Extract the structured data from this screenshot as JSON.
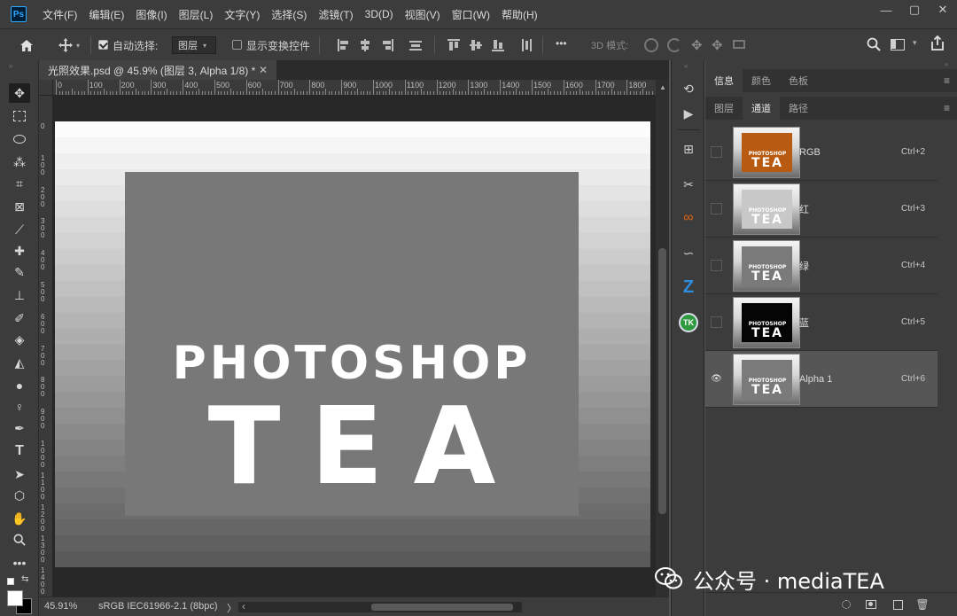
{
  "app": {
    "logo": "Ps"
  },
  "menubar": {
    "items": [
      "文件(F)",
      "编辑(E)",
      "图像(I)",
      "图层(L)",
      "文字(Y)",
      "选择(S)",
      "滤镜(T)",
      "3D(D)",
      "视图(V)",
      "窗口(W)",
      "帮助(H)"
    ],
    "window_controls": {
      "minimize": "—",
      "maximize": "▢",
      "close": "✕"
    }
  },
  "options": {
    "auto_select_label": "自动选择:",
    "auto_select_checked": true,
    "auto_select_target": "图层",
    "show_transform_label": "显示变换控件",
    "show_transform_checked": false,
    "more": "•••",
    "mode_3d_label": "3D 模式:"
  },
  "document": {
    "tab_title": "光照效果.psd @ 45.9% (图层 3, Alpha 1/8) *",
    "close": "✕",
    "canvas_text_top": "PHOTOSHOP",
    "canvas_text_bottom": "TEA",
    "colors": {
      "inner_rect": "#787878",
      "text": "#ffffff"
    }
  },
  "ruler": {
    "h_labels": [
      "0",
      "100",
      "200",
      "300",
      "400",
      "500",
      "600",
      "700",
      "800",
      "900",
      "1000",
      "1100",
      "1200",
      "1300",
      "1400",
      "1500",
      "1600",
      "1700",
      "1800"
    ],
    "v_labels": [
      "0",
      "1\n0\n0",
      "2\n0\n0",
      "3\n0\n0",
      "4\n0\n0",
      "5\n0\n0",
      "6\n0\n0",
      "7\n0\n0",
      "8\n0\n0",
      "9\n0\n0",
      "1\n0\n0\n0",
      "1\n1\n0\n0",
      "1\n2\n0\n0",
      "1\n3\n0\n0",
      "1\n4\n0\n0"
    ]
  },
  "status": {
    "zoom": "45.91%",
    "color_profile": "sRGB IEC61966-2.1 (8bpc)",
    "arrow_right": "〉",
    "arrow_left": "‹"
  },
  "panels": {
    "top_tabs": [
      "信息",
      "颜色",
      "色板"
    ],
    "top_active": 0,
    "bottom_tabs": [
      "图层",
      "通道",
      "路径"
    ],
    "bottom_active": 1,
    "menu_icon": "≡",
    "channels": [
      {
        "name": "RGB",
        "shortcut": "Ctrl+2",
        "visible": false,
        "thumb_fill": "#b85a10",
        "selected": false
      },
      {
        "name": "红",
        "shortcut": "Ctrl+3",
        "visible": false,
        "thumb_fill": "#c8c8c8",
        "selected": false
      },
      {
        "name": "绿",
        "shortcut": "Ctrl+4",
        "visible": false,
        "thumb_fill": "#7a7a7a",
        "selected": false
      },
      {
        "name": "蓝",
        "shortcut": "Ctrl+5",
        "visible": false,
        "thumb_fill": "#050505",
        "selected": false
      },
      {
        "name": "Alpha 1",
        "shortcut": "Ctrl+6",
        "visible": true,
        "thumb_fill": "#7a7a7a",
        "selected": true
      }
    ],
    "thumb_text_top": "PHOTOSHOP",
    "thumb_text_bottom": "TEA",
    "eye_glyph": "👁"
  },
  "watermark": {
    "text": "公众号 · mediaTEA"
  }
}
